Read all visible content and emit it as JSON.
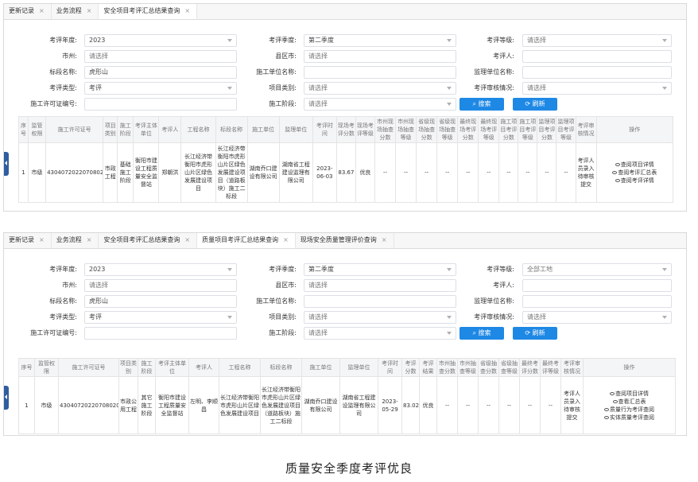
{
  "panel1": {
    "tabs": [
      "更新记录",
      "业务流程",
      "安全项目考评汇总结果查询"
    ],
    "form": {
      "year_label": "考评年度:",
      "year_value": "2023",
      "season_label": "考评季度:",
      "season_value": "第二季度",
      "grade_label": "考评等级:",
      "grade_value": "请选择",
      "city_label": "市州:",
      "city_value": "请选择",
      "county_label": "县区市:",
      "county_value": "请选择",
      "evaluator_label": "考评人:",
      "evaluator_value": "",
      "section_label": "标段名称:",
      "section_value": "虎形山",
      "contractor_label": "施工单位名称:",
      "contractor_value": "",
      "supervisor_label": "监理单位名称:",
      "supervisor_value": "",
      "eval_type_label": "考评类型:",
      "eval_type_value": "考评",
      "project_type_label": "项目类别:",
      "project_type_value": "请选择",
      "audit_label": "考评审核情况:",
      "audit_value": "请选择",
      "permit_label": "施工许可证编号:",
      "permit_value": "",
      "stage_label": "施工阶段:",
      "stage_value": "请选择",
      "search_label": "搜索",
      "refresh_label": "刷新"
    },
    "headers": [
      "序号",
      "监管权限",
      "施工许可证号",
      "项目类别",
      "施工阶段",
      "考评主体单位",
      "考评人",
      "工程名称",
      "标段名称",
      "施工单位",
      "监理单位",
      "考评时间",
      "现场考评分数",
      "现场考评等级",
      "市州现场抽查分数",
      "市州现场抽查等级",
      "省级现场抽查分数",
      "省级现场抽查等级",
      "最终现场考评分数",
      "最终现场考评等级",
      "施工项目考评分数",
      "施工项目考评等级",
      "监理项目考评分数",
      "监理项目考评等级",
      "考评审核情况",
      "操作"
    ],
    "row": [
      "1",
      "市级",
      "430407202207080201",
      "市政工程",
      "基础施工阶段",
      "衡阳市建设工程质量安全监督站",
      "郑朝洪",
      "长江经济带衡阳市虎形山片区绿色发展建设项目",
      "长江经济带衡阳市虎形山片区绿色发展建设项目（道路板块）施工二标段",
      "湖南乔口建设有限公司",
      "湖南省工程建设监理有限公司",
      "2023-06-03",
      "83.67",
      "优良",
      "--",
      "--",
      "--",
      "--",
      "--",
      "--",
      "--",
      "--",
      "--",
      "--",
      "考评人员录入待审核提交"
    ],
    "ops": [
      "查阅项目详情",
      "查阅考评汇总表",
      "查阅考评详情"
    ]
  },
  "panel2": {
    "tabs": [
      "更新记录",
      "业务流程",
      "安全项目考评汇总结果查询",
      "质量项目考评汇总结果查询",
      "现场安全质量管理评价查询"
    ],
    "form": {
      "year_label": "考评年度:",
      "year_value": "2023",
      "season_label": "考评季度:",
      "season_value": "第二季度",
      "grade_label": "考评等级:",
      "grade_value": "全部工地",
      "city_label": "市州:",
      "city_value": "请选择",
      "county_label": "县区市:",
      "county_value": "请选择",
      "evaluator_label": "考评人:",
      "evaluator_value": "",
      "section_label": "标段名称:",
      "section_value": "虎形山",
      "contractor_label": "施工单位名称:",
      "contractor_value": "",
      "supervisor_label": "监理单位名称:",
      "supervisor_value": "",
      "eval_type_label": "考评类型:",
      "eval_type_value": "考评",
      "project_type_label": "项目类别:",
      "project_type_value": "请选择",
      "audit_label": "考评审核情况:",
      "audit_value": "请选择",
      "permit_label": "施工许可证编号:",
      "permit_value": "",
      "stage_label": "施工阶段:",
      "stage_value": "请选择",
      "search_label": "搜索",
      "refresh_label": "刷新"
    },
    "headers": [
      "序号",
      "监管权限",
      "施工许可证号",
      "项目类别",
      "施工阶段",
      "考评主体单位",
      "考评人",
      "工程名称",
      "标段名称",
      "施工单位",
      "监理单位",
      "考评时间",
      "考评分数",
      "考评结果",
      "市州抽查分数",
      "市州抽查等级",
      "省级抽查分数",
      "省级抽查等级",
      "最终考评分数",
      "最终考评等级",
      "考评审核情况",
      "操作"
    ],
    "row": [
      "1",
      "市级",
      "430407202207080201",
      "市政公用工程",
      "其它施工阶段",
      "衡阳市建设工程质量安全监督站",
      "左明、李顺昌",
      "长江经济带衡阳市虎形山片区绿色发展建设项目",
      "长江经济带衡阳市虎形山片区绿色发展建设项目（道路板块）施工二标段",
      "湖南乔口建设有限公司",
      "湖南省工程建设监理有限公司",
      "2023-05-29",
      "83.02",
      "优良",
      "--",
      "--",
      "--",
      "--",
      "--",
      "--",
      "考评人员录入待审核提交"
    ],
    "ops": [
      "查阅项目详情",
      "查看汇总表",
      "质量行为考评查阅",
      "实体质量考评查阅"
    ]
  },
  "caption": "质量安全季度考评优良",
  "colors": {
    "accent": "#1e88e5",
    "danger": "#e60012",
    "handle": "#2f5d9e"
  }
}
